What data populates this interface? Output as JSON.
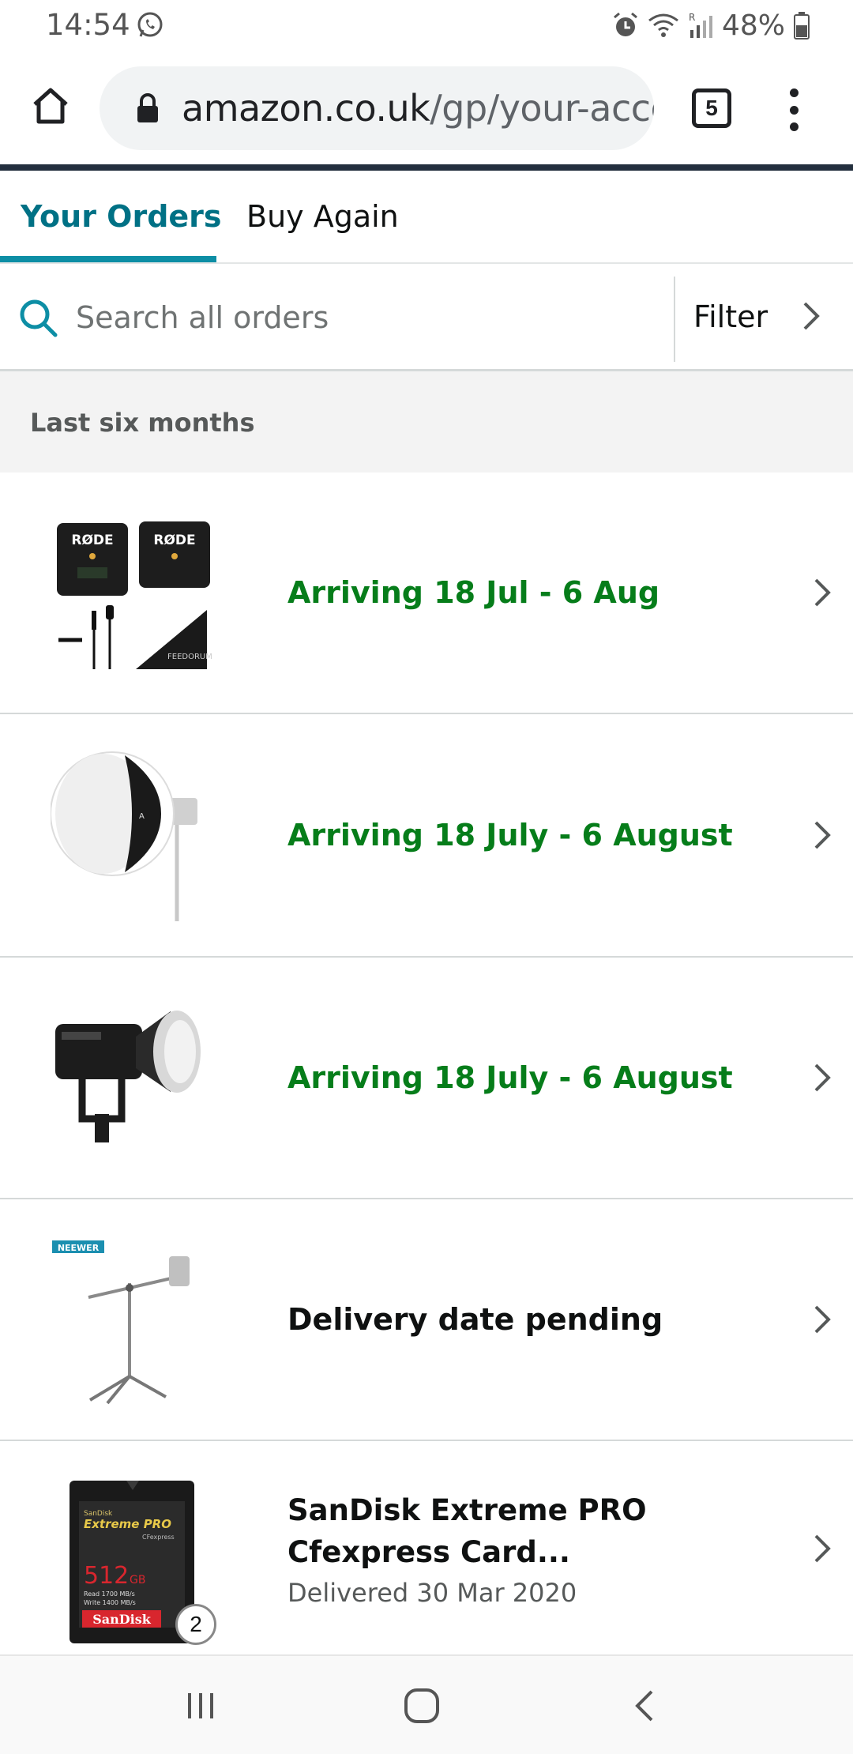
{
  "status_bar": {
    "time": "14:54",
    "battery": "48%",
    "icons": [
      "whatsapp-icon",
      "alarm-icon",
      "wifi-icon",
      "signal-icon",
      "battery-icon"
    ]
  },
  "browser": {
    "url_domain": "amazon.co.uk",
    "url_path": "/gp/your-acco",
    "tab_count": "5"
  },
  "tabs": [
    {
      "label": "Your Orders",
      "active": true
    },
    {
      "label": "Buy Again",
      "active": false
    }
  ],
  "search": {
    "placeholder": "Search all orders",
    "filter_label": "Filter"
  },
  "section": {
    "title": "Last six months"
  },
  "orders": [
    {
      "status": "Arriving 18 Jul - 6 Aug",
      "image": "rode-wireless-mic-kit"
    },
    {
      "status": "Arriving 18 July - 6 August",
      "image": "lantern-softbox"
    },
    {
      "status": "Arriving 18 July - 6 August",
      "image": "video-light"
    },
    {
      "status": "Delivery date pending",
      "image": "c-stand",
      "brand": "NEEWER"
    },
    {
      "title": "SanDisk Extreme PRO Cfexpress Card...",
      "status": "Delivered 30 Mar 2020",
      "image": "sandisk-card",
      "quantity": "2",
      "card_text": {
        "line1": "SanDisk",
        "line2": "Extreme PRO",
        "line3": "CFexpress",
        "capacity": "512",
        "unit": "GB",
        "speed1": "Read 1700 MB/s",
        "speed2": "Write 1400 MB/s",
        "brand": "SanDisk"
      }
    }
  ],
  "product_text": {
    "rode_1": "RØDE",
    "rode_2": "RØDE",
    "cloth": "FEEDORUM"
  },
  "colors": {
    "link_teal": "#007185",
    "tab_underline": "#0d8ea5",
    "status_green": "#067d1a",
    "header_dark": "#232f3e"
  }
}
